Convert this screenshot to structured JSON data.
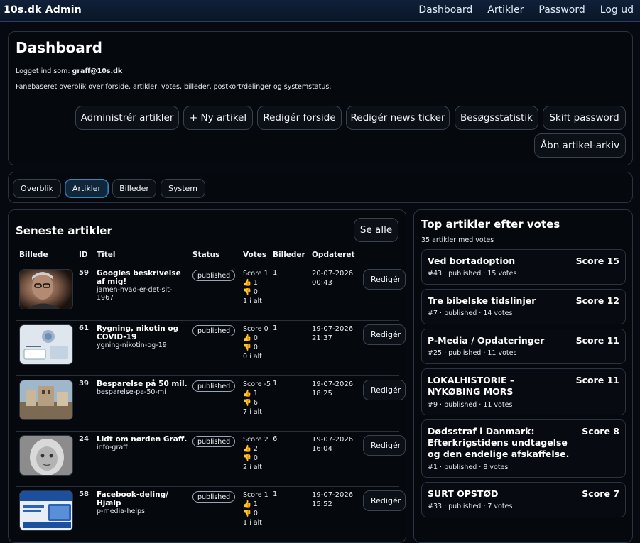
{
  "brand": "10s.dk Admin",
  "nav": [
    "Dashboard",
    "Artikler",
    "Password",
    "Log ud"
  ],
  "header": {
    "title": "Dashboard",
    "login_label": "Logget ind som:",
    "login_user": "graff@10s.dk",
    "description": "Fanebaseret overblik over forside, artikler, votes, billeder, postkort/delinger og systemstatus.",
    "actions": [
      "Administrér artikler",
      "+ Ny artikel",
      "Redigér forside",
      "Redigér news ticker",
      "Besøgsstatistik",
      "Skift password",
      "Åbn artikel-arkiv"
    ]
  },
  "tabs": [
    "Overblik",
    "Artikler",
    "Billeder",
    "System"
  ],
  "active_tab": "Artikler",
  "latest": {
    "title": "Seneste artikler",
    "see_all": "Se alle",
    "columns": [
      "Billede",
      "ID",
      "Titel",
      "Status",
      "Votes",
      "Billeder",
      "Opdateret"
    ],
    "edit_label": "Redigér",
    "rows": [
      {
        "id": "59",
        "title": "Googles beskrivelse af mig!",
        "slug": "jamen-hvad-er-det-sit-1967",
        "status": "published",
        "score": "Score 1",
        "up": "1 ·",
        "down": "0 ·",
        "total": "1 i alt",
        "images": "1",
        "date": "20-07-2026",
        "time": "00:43"
      },
      {
        "id": "61",
        "title": "Rygning, nikotin og COVID-19",
        "slug": "ygning-nikotin-og-19",
        "status": "published",
        "score": "Score 0",
        "up": "0 ·",
        "down": "0 ·",
        "total": "0 i alt",
        "images": "1",
        "date": "19-07-2026",
        "time": "21:37"
      },
      {
        "id": "39",
        "title": "Besparelse på 50 mil.",
        "slug": "besparelse-pa-50-mi",
        "status": "published",
        "score": "Score -5",
        "up": "1 ·",
        "down": "6 ·",
        "total": "7 i alt",
        "images": "1",
        "date": "19-07-2026",
        "time": "18:25"
      },
      {
        "id": "24",
        "title": "Lidt om nørden Graff.",
        "slug": "info-graff",
        "status": "published",
        "score": "Score 2",
        "up": "2 ·",
        "down": "0 ·",
        "total": "2 i alt",
        "images": "6",
        "date": "19-07-2026",
        "time": "16:04"
      },
      {
        "id": "58",
        "title": "Facebook-deling/ Hjælp",
        "slug": "p-media-helps",
        "status": "published",
        "score": "Score 1",
        "up": "1 ·",
        "down": "0 ·",
        "total": "1 i alt",
        "images": "1",
        "date": "19-07-2026",
        "time": "15:52"
      }
    ]
  },
  "top": {
    "title": "Top artikler efter votes",
    "count": "35 artikler med votes",
    "items": [
      {
        "title": "Ved bortadoption",
        "score": "Score 15",
        "meta": "#43 · published · 15 votes"
      },
      {
        "title": "Tre bibelske tidslinjer",
        "score": "Score 12",
        "meta": "#7 · published · 14 votes"
      },
      {
        "title": "P-Media / Opdateringer",
        "score": "Score 11",
        "meta": "#25 · published · 11 votes"
      },
      {
        "title": "LOKALHISTORIE – NYKØBING MORS",
        "score": "Score 11",
        "meta": "#9 · published · 11 votes"
      },
      {
        "title": "Dødsstraf i Danmark: Efterkrigstidens undtagelse og den endelige afskaffelse.",
        "score": "Score 8",
        "meta": "#1 · published · 8 votes"
      },
      {
        "title": "SURT OPSTØD",
        "score": "Score 7",
        "meta": "#33 · published · 7 votes"
      }
    ]
  },
  "colors": {
    "accent": "#3e86b8",
    "panel_border": "#2c3340",
    "background": "#06090f"
  }
}
